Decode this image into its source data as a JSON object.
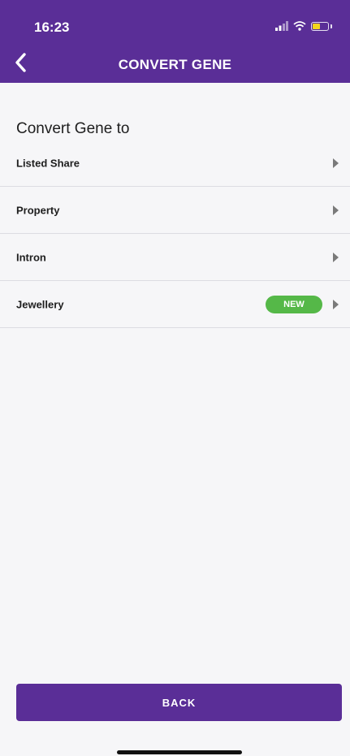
{
  "status_bar": {
    "time": "16:23",
    "icons": [
      "signal-icon",
      "wifi-icon",
      "battery-icon"
    ],
    "battery_color": "#f3d61c"
  },
  "header": {
    "title": "CONVERT GENE",
    "back_icon": "chevron-left-icon",
    "background_color": "#5a2e97"
  },
  "section": {
    "heading": "Convert Gene to"
  },
  "options": [
    {
      "label": "Listed Share",
      "badge": ""
    },
    {
      "label": "Property",
      "badge": ""
    },
    {
      "label": "Intron",
      "badge": ""
    },
    {
      "label": "Jewellery",
      "badge": "NEW"
    }
  ],
  "badge_color": "#55b848",
  "footer": {
    "back_label": "BACK"
  }
}
